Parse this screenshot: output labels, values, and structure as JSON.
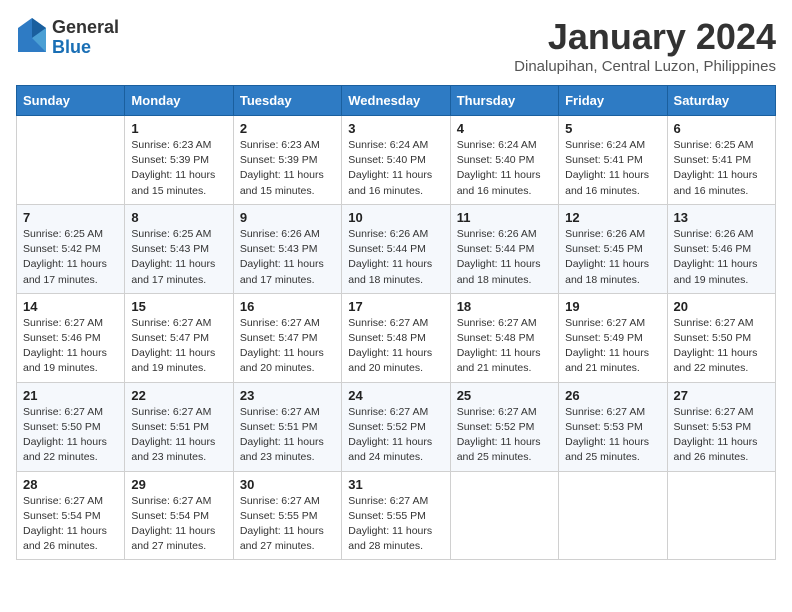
{
  "header": {
    "logo": {
      "general": "General",
      "blue": "Blue"
    },
    "title": "January 2024",
    "subtitle": "Dinalupihan, Central Luzon, Philippines"
  },
  "weekdays": [
    "Sunday",
    "Monday",
    "Tuesday",
    "Wednesday",
    "Thursday",
    "Friday",
    "Saturday"
  ],
  "weeks": [
    [
      {
        "day": "",
        "info": ""
      },
      {
        "day": "1",
        "info": "Sunrise: 6:23 AM\nSunset: 5:39 PM\nDaylight: 11 hours and 15 minutes."
      },
      {
        "day": "2",
        "info": "Sunrise: 6:23 AM\nSunset: 5:39 PM\nDaylight: 11 hours and 15 minutes."
      },
      {
        "day": "3",
        "info": "Sunrise: 6:24 AM\nSunset: 5:40 PM\nDaylight: 11 hours and 16 minutes."
      },
      {
        "day": "4",
        "info": "Sunrise: 6:24 AM\nSunset: 5:40 PM\nDaylight: 11 hours and 16 minutes."
      },
      {
        "day": "5",
        "info": "Sunrise: 6:24 AM\nSunset: 5:41 PM\nDaylight: 11 hours and 16 minutes."
      },
      {
        "day": "6",
        "info": "Sunrise: 6:25 AM\nSunset: 5:41 PM\nDaylight: 11 hours and 16 minutes."
      }
    ],
    [
      {
        "day": "7",
        "info": "Sunrise: 6:25 AM\nSunset: 5:42 PM\nDaylight: 11 hours and 17 minutes."
      },
      {
        "day": "8",
        "info": "Sunrise: 6:25 AM\nSunset: 5:43 PM\nDaylight: 11 hours and 17 minutes."
      },
      {
        "day": "9",
        "info": "Sunrise: 6:26 AM\nSunset: 5:43 PM\nDaylight: 11 hours and 17 minutes."
      },
      {
        "day": "10",
        "info": "Sunrise: 6:26 AM\nSunset: 5:44 PM\nDaylight: 11 hours and 18 minutes."
      },
      {
        "day": "11",
        "info": "Sunrise: 6:26 AM\nSunset: 5:44 PM\nDaylight: 11 hours and 18 minutes."
      },
      {
        "day": "12",
        "info": "Sunrise: 6:26 AM\nSunset: 5:45 PM\nDaylight: 11 hours and 18 minutes."
      },
      {
        "day": "13",
        "info": "Sunrise: 6:26 AM\nSunset: 5:46 PM\nDaylight: 11 hours and 19 minutes."
      }
    ],
    [
      {
        "day": "14",
        "info": "Sunrise: 6:27 AM\nSunset: 5:46 PM\nDaylight: 11 hours and 19 minutes."
      },
      {
        "day": "15",
        "info": "Sunrise: 6:27 AM\nSunset: 5:47 PM\nDaylight: 11 hours and 19 minutes."
      },
      {
        "day": "16",
        "info": "Sunrise: 6:27 AM\nSunset: 5:47 PM\nDaylight: 11 hours and 20 minutes."
      },
      {
        "day": "17",
        "info": "Sunrise: 6:27 AM\nSunset: 5:48 PM\nDaylight: 11 hours and 20 minutes."
      },
      {
        "day": "18",
        "info": "Sunrise: 6:27 AM\nSunset: 5:48 PM\nDaylight: 11 hours and 21 minutes."
      },
      {
        "day": "19",
        "info": "Sunrise: 6:27 AM\nSunset: 5:49 PM\nDaylight: 11 hours and 21 minutes."
      },
      {
        "day": "20",
        "info": "Sunrise: 6:27 AM\nSunset: 5:50 PM\nDaylight: 11 hours and 22 minutes."
      }
    ],
    [
      {
        "day": "21",
        "info": "Sunrise: 6:27 AM\nSunset: 5:50 PM\nDaylight: 11 hours and 22 minutes."
      },
      {
        "day": "22",
        "info": "Sunrise: 6:27 AM\nSunset: 5:51 PM\nDaylight: 11 hours and 23 minutes."
      },
      {
        "day": "23",
        "info": "Sunrise: 6:27 AM\nSunset: 5:51 PM\nDaylight: 11 hours and 23 minutes."
      },
      {
        "day": "24",
        "info": "Sunrise: 6:27 AM\nSunset: 5:52 PM\nDaylight: 11 hours and 24 minutes."
      },
      {
        "day": "25",
        "info": "Sunrise: 6:27 AM\nSunset: 5:52 PM\nDaylight: 11 hours and 25 minutes."
      },
      {
        "day": "26",
        "info": "Sunrise: 6:27 AM\nSunset: 5:53 PM\nDaylight: 11 hours and 25 minutes."
      },
      {
        "day": "27",
        "info": "Sunrise: 6:27 AM\nSunset: 5:53 PM\nDaylight: 11 hours and 26 minutes."
      }
    ],
    [
      {
        "day": "28",
        "info": "Sunrise: 6:27 AM\nSunset: 5:54 PM\nDaylight: 11 hours and 26 minutes."
      },
      {
        "day": "29",
        "info": "Sunrise: 6:27 AM\nSunset: 5:54 PM\nDaylight: 11 hours and 27 minutes."
      },
      {
        "day": "30",
        "info": "Sunrise: 6:27 AM\nSunset: 5:55 PM\nDaylight: 11 hours and 27 minutes."
      },
      {
        "day": "31",
        "info": "Sunrise: 6:27 AM\nSunset: 5:55 PM\nDaylight: 11 hours and 28 minutes."
      },
      {
        "day": "",
        "info": ""
      },
      {
        "day": "",
        "info": ""
      },
      {
        "day": "",
        "info": ""
      }
    ]
  ]
}
